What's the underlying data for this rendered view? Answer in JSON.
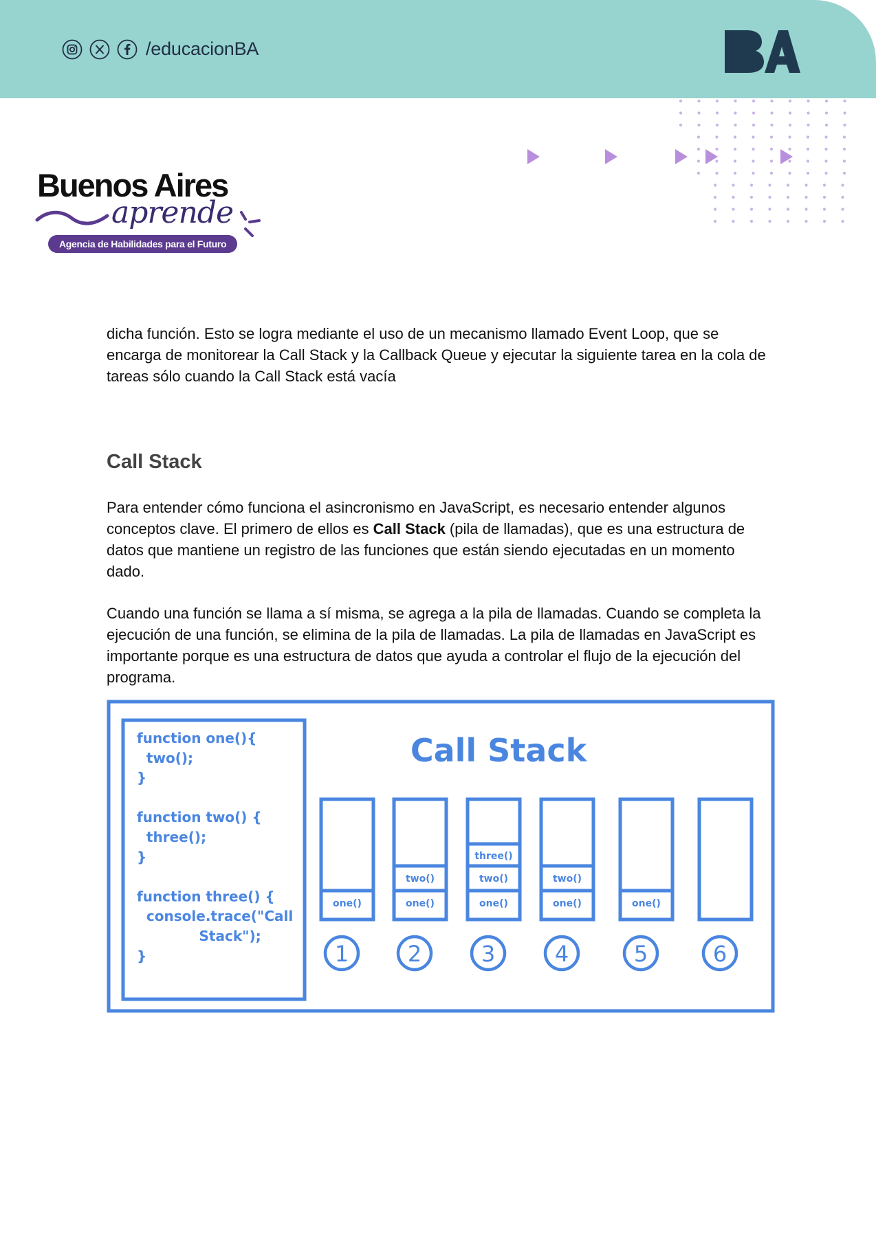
{
  "header": {
    "social_handle": "/educacionBA",
    "social_icons": [
      "instagram-icon",
      "x-icon",
      "facebook-icon"
    ],
    "logo_text": "BA",
    "band_color": "#97d3cf",
    "logo_color": "#1f3a4f"
  },
  "brand": {
    "title": "Buenos Aires",
    "subtitle": "aprende",
    "tagline": "Agencia de Habilidades para el Futuro",
    "accent_color": "#5b3a8f"
  },
  "body": {
    "paragraph1": "dicha función. Esto se logra mediante el uso de un mecanismo llamado Event Loop, que se encarga de monitorear la Call Stack y la Callback Queue y ejecutar la siguiente tarea en la cola de tareas sólo cuando la Call Stack está vacía",
    "heading": "Call Stack",
    "paragraph2_before": "Para entender cómo funciona el asincronismo en JavaScript, es necesario entender algunos conceptos clave. El primero de ellos es ",
    "paragraph2_bold": "Call Stack",
    "paragraph2_after": " (pila de llamadas), que es una estructura de datos que mantiene un registro de las funciones que están siendo ejecutadas en un momento dado.",
    "paragraph3": "Cuando una función se llama a sí misma, se agrega a la pila de llamadas. Cuando se completa la ejecución de una función, se elimina de la pila de llamadas. La pila de llamadas en JavaScript es importante porque es una estructura de datos que ayuda a controlar el flujo de la ejecución del programa."
  },
  "diagram": {
    "title": "Call Stack",
    "color": "#4a86e0",
    "code_lines": [
      "function one(){",
      "  two();",
      "}",
      "",
      "function two() {",
      "  three();",
      "}",
      "",
      "function three() {",
      "  console.trace(\"Call",
      "             Stack\");",
      "}"
    ],
    "stacks": [
      {
        "step": "1",
        "frames": [
          "one()"
        ]
      },
      {
        "step": "2",
        "frames": [
          "one()",
          "two()"
        ]
      },
      {
        "step": "3",
        "frames": [
          "one()",
          "two()",
          "three()"
        ]
      },
      {
        "step": "4",
        "frames": [
          "one()",
          "two()"
        ]
      },
      {
        "step": "5",
        "frames": [
          "one()"
        ]
      },
      {
        "step": "6",
        "frames": []
      }
    ]
  }
}
